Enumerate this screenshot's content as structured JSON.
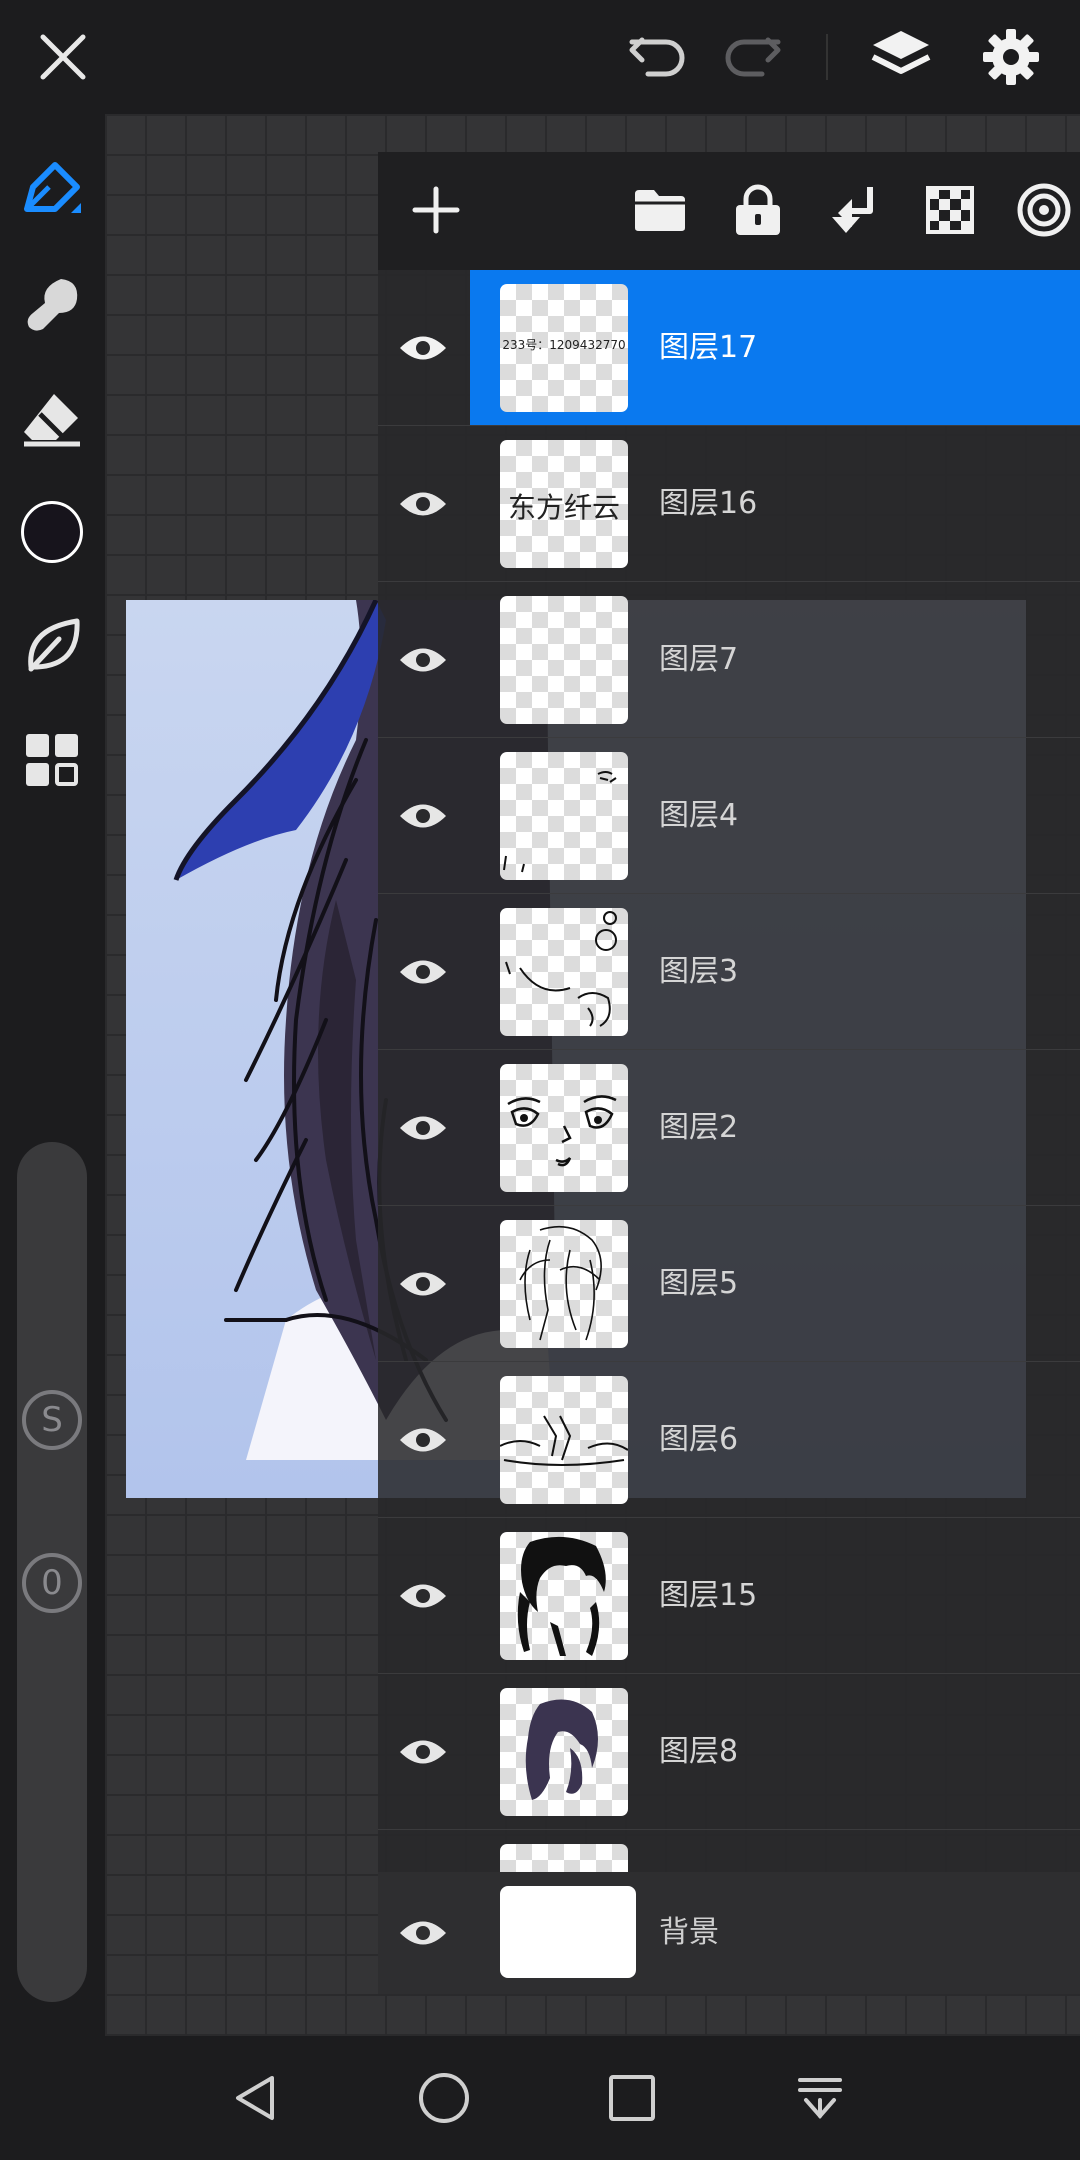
{
  "app": {
    "accent": "#0a79ef"
  },
  "topbar": {
    "close_icon": "close-icon",
    "undo_icon": "undo-icon",
    "redo_icon": "redo-icon",
    "layers_icon": "layers-icon",
    "settings_icon": "gear-icon"
  },
  "tools": {
    "items": [
      "pen-icon",
      "smudge-icon",
      "eraser-icon",
      "color-swatch",
      "leaf-icon",
      "grid-icon"
    ],
    "current_color": "#17141c",
    "size_slider_label": "S",
    "opacity_slider_label": "0"
  },
  "layer_panel": {
    "toolbar_icons": [
      "add-icon",
      "folder-icon",
      "lock-icon",
      "merge-down-icon",
      "checkerboard-icon",
      "target-icon"
    ],
    "layers": [
      {
        "name": "图层17",
        "thumb_text": "233号：1209432770",
        "selected": true
      },
      {
        "name": "图层16",
        "thumb_text": "东方纤云",
        "selected": false
      },
      {
        "name": "图层7",
        "thumb_text": "",
        "selected": false
      },
      {
        "name": "图层4",
        "thumb_text": "",
        "selected": false
      },
      {
        "name": "图层3",
        "thumb_text": "",
        "selected": false
      },
      {
        "name": "图层2",
        "thumb_text": "",
        "selected": false
      },
      {
        "name": "图层5",
        "thumb_text": "",
        "selected": false
      },
      {
        "name": "图层6",
        "thumb_text": "",
        "selected": false
      },
      {
        "name": "图层15",
        "thumb_text": "",
        "selected": false
      },
      {
        "name": "图层8",
        "thumb_text": "",
        "selected": false
      }
    ],
    "background_layer": {
      "name": "背景"
    }
  },
  "navbar": {
    "icons": [
      "back-icon",
      "home-icon",
      "recents-icon",
      "notification-icon"
    ]
  }
}
